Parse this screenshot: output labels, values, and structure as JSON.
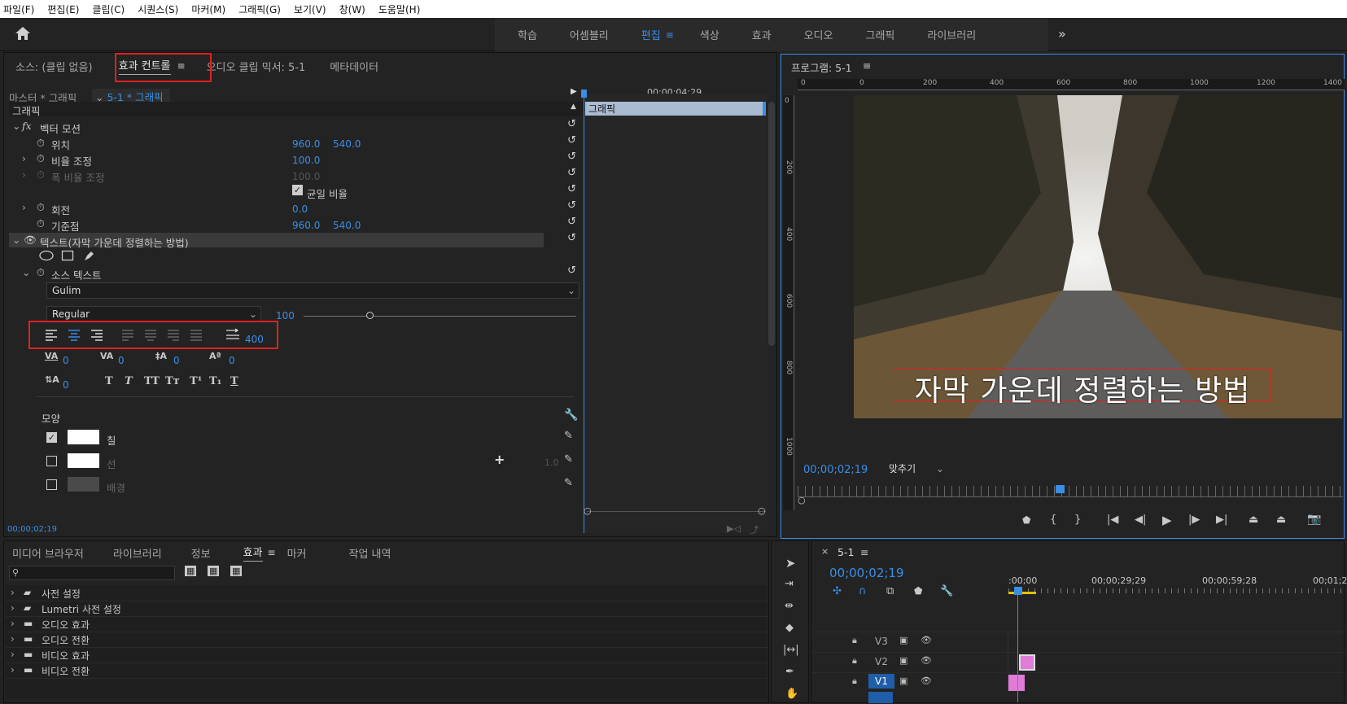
{
  "menubar": {
    "items": [
      "파일(F)",
      "편집(E)",
      "클립(C)",
      "시퀀스(S)",
      "마커(M)",
      "그래픽(G)",
      "보기(V)",
      "창(W)",
      "도움말(H)"
    ]
  },
  "workspaces": {
    "items": [
      "학습",
      "어셈블리",
      "편집",
      "색상",
      "효과",
      "오디오",
      "그래픽",
      "라이브러리"
    ],
    "active": "편집",
    "more": "»"
  },
  "source_panel": {
    "tabs": [
      "소스: (클립 없음)",
      "효과 컨트롤",
      "오디오 클립 믹서: 5-1",
      "메타데이터"
    ],
    "master": "마스터 * 그래픽",
    "clip": "5-1 * 그래픽",
    "timecode_header": "00;00;04;29",
    "section": "그래픽",
    "timeline_clip": "그래픽",
    "vector_motion": "벡터 모션",
    "position_label": "위치",
    "position_x": "960.0",
    "position_y": "540.0",
    "scale_label": "비율 조정",
    "scale_val": "100.0",
    "scale_width_label": "폭 비율 조정",
    "scale_width_val": "100.0",
    "uniform_label": "균일 비율",
    "rotation_label": "회전",
    "rotation_val": "0.0",
    "anchor_label": "기준점",
    "anchor_x": "960.0",
    "anchor_y": "540.0",
    "text_layer": "텍스트(자막 가운데 정렬하는 방법)",
    "source_text": "소스 텍스트",
    "font": "Gulim",
    "style": "Regular",
    "font_size": "100",
    "tab_width": "400",
    "kerning": "0",
    "tracking": "0",
    "leading": "0",
    "baseline": "0",
    "tsume": "0",
    "appearance": "모양",
    "fill_label": "칠",
    "stroke_label": "선",
    "stroke_width": "1.0",
    "bg_label": "배경",
    "timecode": "00;00;02;19"
  },
  "program_panel": {
    "title": "프로그램: 5-1",
    "ruler_labels": [
      "0",
      "0",
      "200",
      "400",
      "600",
      "800",
      "1000",
      "1200",
      "1400"
    ],
    "vruler_labels": [
      "0",
      "200",
      "400",
      "600",
      "800",
      "1000"
    ],
    "subtitle": "자막 가운데 정렬하는 방법",
    "timecode": "00;00;02;19",
    "fit": "맞추기"
  },
  "effects_panel": {
    "tabs": [
      "미디어 브라우저",
      "라이브러리",
      "정보",
      "효과",
      "마커",
      "작업 내역"
    ],
    "active_tab": "효과",
    "folders": [
      "사전 설정",
      "Lumetri 사전 설정",
      "오디오 효과",
      "오디오 전환",
      "비디오 효과",
      "비디오 전환"
    ]
  },
  "timeline_panel": {
    "title": "5-1",
    "timecode": "00;00;02;19",
    "ruler": [
      ":00;00",
      "00;00;29;29",
      "00;00;59;28",
      "00;01;2"
    ],
    "tracks": [
      "V3",
      "V2",
      "V1"
    ]
  },
  "colors": {
    "accent": "#3a8ee6",
    "highlight_box": "#e02020",
    "clip_pink": "#e07bd8"
  }
}
